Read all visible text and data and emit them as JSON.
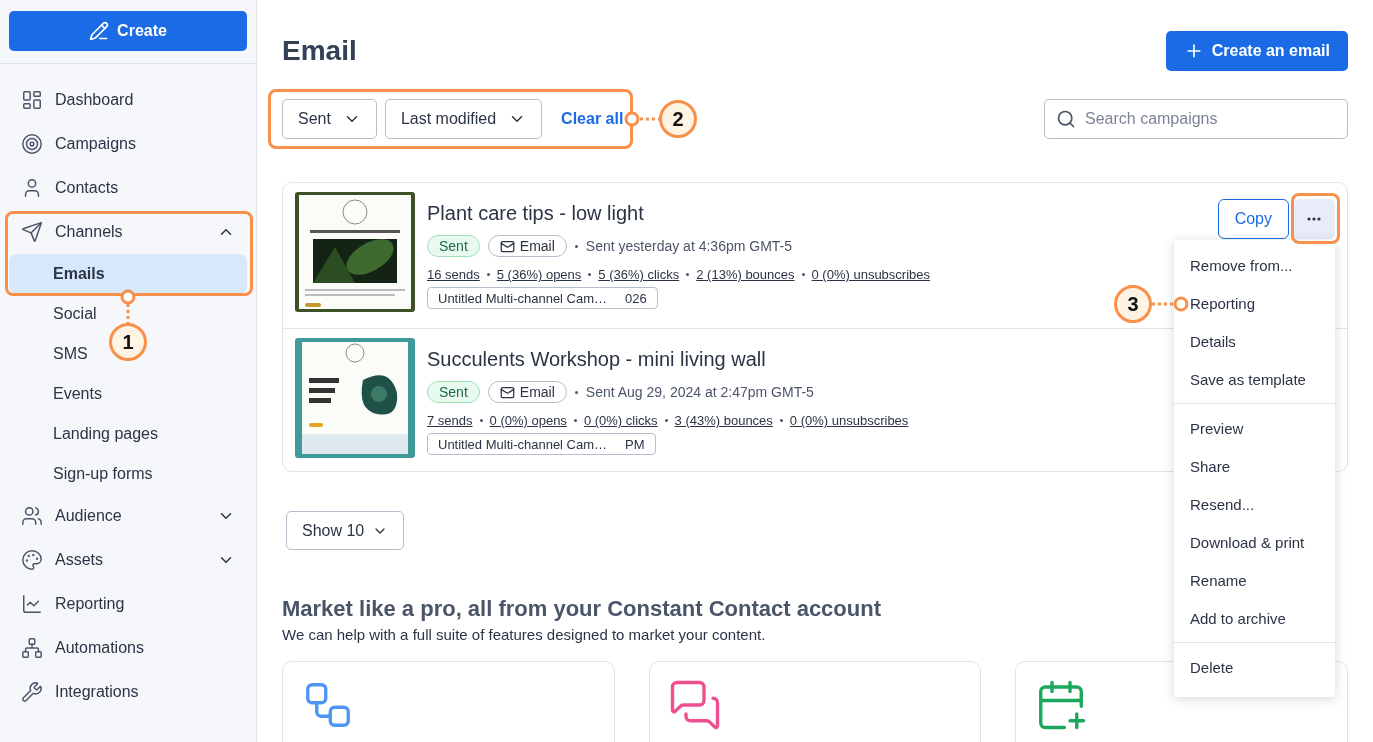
{
  "sidebar": {
    "create_button": "Create",
    "items": [
      {
        "kind": "link",
        "label": "Dashboard"
      },
      {
        "kind": "link",
        "label": "Campaigns"
      },
      {
        "kind": "link",
        "label": "Contacts"
      },
      {
        "kind": "group",
        "label": "Channels",
        "expanded": true,
        "children": [
          {
            "label": "Emails",
            "selected": true
          },
          {
            "label": "Social",
            "selected": false
          },
          {
            "label": "SMS",
            "selected": false
          },
          {
            "label": "Events",
            "selected": false
          },
          {
            "label": "Landing pages",
            "selected": false
          },
          {
            "label": "Sign-up forms",
            "selected": false
          }
        ]
      },
      {
        "kind": "group",
        "label": "Audience",
        "expanded": false
      },
      {
        "kind": "group",
        "label": "Assets",
        "expanded": false
      },
      {
        "kind": "link",
        "label": "Reporting"
      },
      {
        "kind": "link",
        "label": "Automations"
      },
      {
        "kind": "link",
        "label": "Integrations"
      }
    ]
  },
  "page": {
    "title": "Email",
    "create_button": "Create an email"
  },
  "filters": {
    "dropdowns": [
      {
        "label": "Sent"
      },
      {
        "label": "Last modified"
      }
    ],
    "clear_link": "Clear all",
    "search": {
      "placeholder": "Search campaigns"
    }
  },
  "campaigns": [
    {
      "title": "Plant care tips - low light",
      "thumbnail": {
        "kind": "picture"
      },
      "status": "Sent",
      "channel": "Email",
      "sent_info": "Sent yesterday at 4:36pm GMT-5",
      "stats": [
        "16 sends",
        "5 (36%) opens",
        "5 (36%) clicks",
        "2 (13%) bounces",
        "0 (0%) unsubscribes"
      ],
      "tag": {
        "name": "Untitled Multi-channel Cam…",
        "suffix": "026"
      },
      "actions": {
        "copy": "Copy",
        "menu_open": true
      }
    },
    {
      "title": "Succulents Workshop - mini living wall",
      "thumbnail": {
        "kind": "picture"
      },
      "status": "Sent",
      "channel": "Email",
      "sent_info": "Sent Aug 29, 2024 at 2:47pm GMT-5",
      "stats": [
        "7 sends",
        "0 (0%) opens",
        "0 (0%) clicks",
        "3 (43%) bounces",
        "0 (0%) unsubscribes"
      ],
      "tag": {
        "name": "Untitled Multi-channel Cam…",
        "suffix": "PM"
      }
    }
  ],
  "action_menu": {
    "groups": [
      [
        "Remove from...",
        "Reporting",
        "Details",
        "Save as template"
      ],
      [
        "Preview",
        "Share",
        "Resend...",
        "Download & print",
        "Rename",
        "Add to archive"
      ],
      [
        "Delete"
      ]
    ]
  },
  "page_size_button": "Show 10",
  "promo": {
    "heading": "Market like a pro, all from your Constant Contact account",
    "text": "We can help with a full suite of features designed to market your content.",
    "features": [
      {
        "kind": "automation"
      },
      {
        "kind": "chat"
      },
      {
        "kind": "calendar"
      }
    ]
  },
  "callouts": [
    {
      "number": "1"
    },
    {
      "number": "2"
    },
    {
      "number": "3"
    }
  ]
}
